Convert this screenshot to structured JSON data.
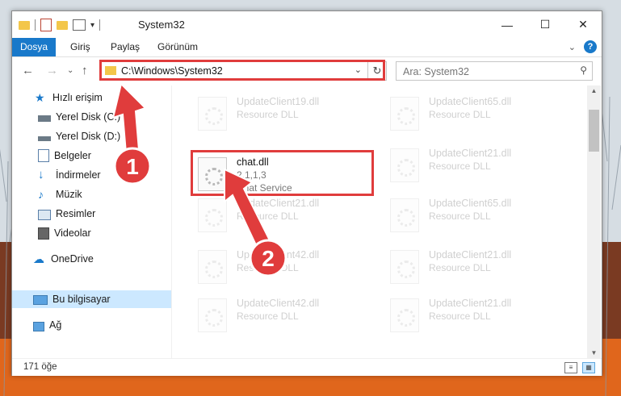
{
  "window": {
    "title": "System32"
  },
  "ribbon": {
    "tabs": [
      "Dosya",
      "Giriş",
      "Paylaş",
      "Görünüm"
    ]
  },
  "navigation": {
    "address": "C:\\Windows\\System32",
    "search_placeholder": "Ara: System32"
  },
  "sidebar": {
    "items": [
      {
        "label": "Hızlı erişim",
        "icon": "star-icon"
      },
      {
        "label": "Yerel Disk (C:)",
        "icon": "drive-icon"
      },
      {
        "label": "Yerel Disk (D:)",
        "icon": "drive-icon"
      },
      {
        "label": "Belgeler",
        "icon": "documents-icon"
      },
      {
        "label": "İndirmeler",
        "icon": "download-icon"
      },
      {
        "label": "Müzik",
        "icon": "music-icon"
      },
      {
        "label": "Resimler",
        "icon": "pictures-icon"
      },
      {
        "label": "Videolar",
        "icon": "videos-icon"
      },
      {
        "label": "OneDrive",
        "icon": "cloud-icon"
      },
      {
        "label": "Bu bilgisayar",
        "icon": "computer-icon"
      },
      {
        "label": "Ağ",
        "icon": "network-icon"
      }
    ]
  },
  "files": {
    "left": [
      {
        "name": "UpdateClient19.dll",
        "type": "Resource DLL"
      },
      {
        "name": "chat.dll",
        "version": "2,1,1,3",
        "type": "Chat Service"
      },
      {
        "name": "UpdateClient21.dll",
        "type": "Resource DLL"
      },
      {
        "name": "UpdateClient42.dll",
        "type": "Resource DLL"
      },
      {
        "name": "UpdateClient42.dll",
        "type": "Resource DLL"
      }
    ],
    "right": [
      {
        "name": "UpdateClient65.dll",
        "type": "Resource DLL"
      },
      {
        "name": "UpdateClient21.dll",
        "type": "Resource DLL"
      },
      {
        "name": "UpdateClient65.dll",
        "type": "Resource DLL"
      },
      {
        "name": "UpdateClient21.dll",
        "type": "Resource DLL"
      },
      {
        "name": "UpdateClient21.dll",
        "type": "Resource DLL"
      }
    ]
  },
  "status": {
    "item_count": "171 öğe"
  },
  "annotations": {
    "step1": "1",
    "step2": "2"
  },
  "colors": {
    "highlight": "#e03c3c",
    "accent": "#1979ca"
  }
}
